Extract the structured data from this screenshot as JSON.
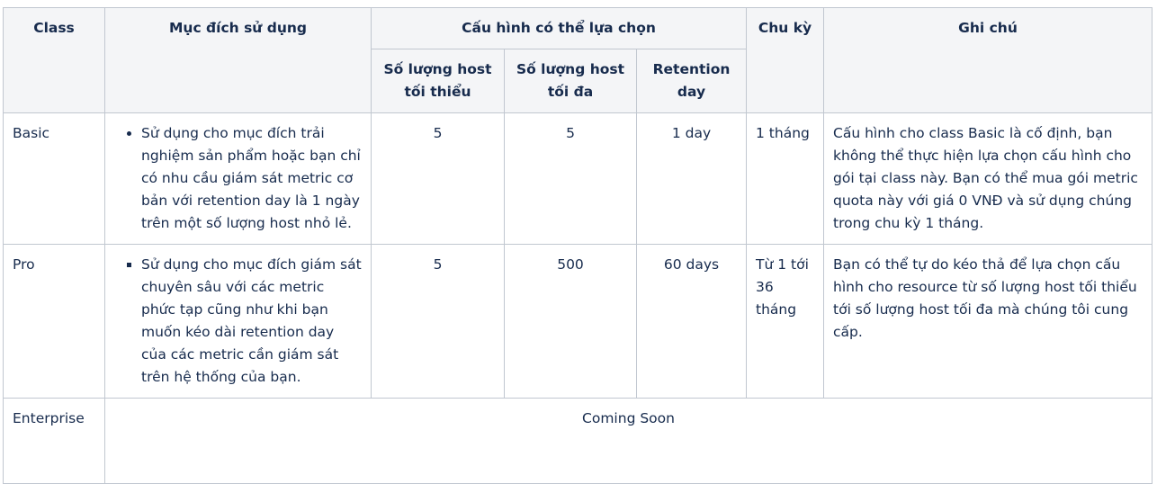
{
  "table": {
    "headers": {
      "class": "Class",
      "purpose": "Mục đích sử dụng",
      "config_group": "Cấu hình có thể lựa chọn",
      "min_hosts": "Số lượng host tối thiểu",
      "max_hosts": "Số lượng host tối đa",
      "retention": "Retention day",
      "cycle": "Chu kỳ",
      "notes": "Ghi chú"
    },
    "rows": [
      {
        "class": "Basic",
        "purpose": "Sử dụng cho mục đích trải nghiệm sản phẩm hoặc bạn chỉ có nhu cầu giám sát metric cơ bản với retention day là 1 ngày trên một số lượng host nhỏ lẻ.",
        "min_hosts": "5",
        "max_hosts": "5",
        "retention": "1 day",
        "cycle": "1 tháng",
        "notes": "Cấu hình cho class Basic là cố định, bạn không thể thực hiện lựa chọn cấu hình cho gói tại class này. Bạn có thể mua gói metric quota này với giá 0 VNĐ và sử dụng chúng trong chu kỳ 1 tháng."
      },
      {
        "class": "Pro",
        "purpose": "Sử dụng cho mục đích giám sát chuyên sâu với các metric phức tạp cũng như khi bạn muốn kéo dài retention day của các metric cần giám sát trên hệ thống của bạn.",
        "min_hosts": "5",
        "max_hosts": "500",
        "retention": "60 days",
        "cycle": "Từ 1 tới 36 tháng",
        "notes": "Bạn có thể tự do kéo thả để lựa chọn cấu hình cho resource từ số lượng host tối thiểu tới số lượng host tối đa mà chúng tôi cung cấp."
      },
      {
        "class": "Enterprise",
        "merged_text": "Coming Soon"
      }
    ]
  }
}
